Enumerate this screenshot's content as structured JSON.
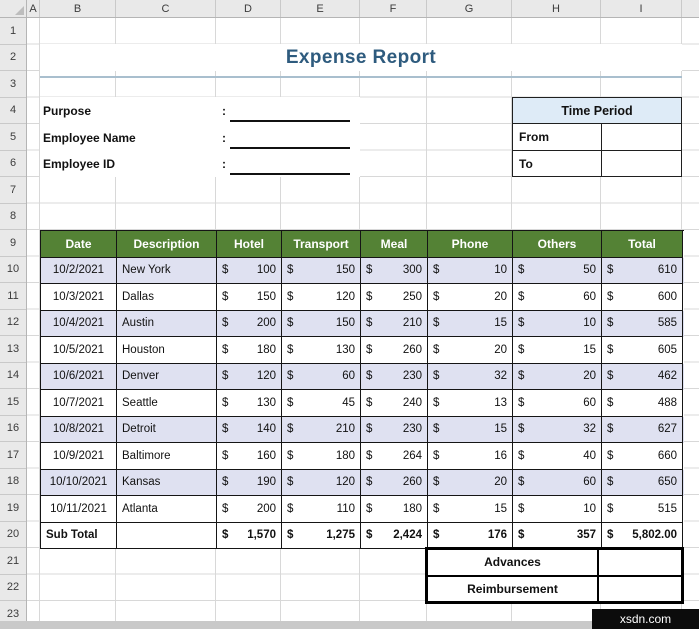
{
  "grid": {
    "columns": [
      "A",
      "B",
      "C",
      "D",
      "E",
      "F",
      "G",
      "H",
      "I"
    ],
    "rows": [
      "1",
      "2",
      "3",
      "4",
      "5",
      "6",
      "7",
      "8",
      "9",
      "10",
      "11",
      "12",
      "13",
      "14",
      "15",
      "16",
      "17",
      "18",
      "19",
      "20",
      "21",
      "22",
      "23"
    ]
  },
  "report": {
    "title": "Expense Report",
    "fields": {
      "purpose": {
        "label": "Purpose",
        "separator": ":",
        "value": ""
      },
      "employee_name": {
        "label": "Employee Name",
        "separator": ":",
        "value": ""
      },
      "employee_id": {
        "label": "Employee ID",
        "separator": ":",
        "value": ""
      }
    },
    "time_period": {
      "header": "Time Period",
      "from_label": "From",
      "from_value": "",
      "to_label": "To",
      "to_value": ""
    }
  },
  "expense_table": {
    "currency": "$",
    "headers": [
      "Date",
      "Description",
      "Hotel",
      "Transport",
      "Meal",
      "Phone",
      "Others",
      "Total"
    ],
    "rows": [
      {
        "date": "10/2/2021",
        "description": "New York",
        "hotel": "100",
        "transport": "150",
        "meal": "300",
        "phone": "10",
        "others": "50",
        "total": "610"
      },
      {
        "date": "10/3/2021",
        "description": "Dallas",
        "hotel": "150",
        "transport": "120",
        "meal": "250",
        "phone": "20",
        "others": "60",
        "total": "600"
      },
      {
        "date": "10/4/2021",
        "description": "Austin",
        "hotel": "200",
        "transport": "150",
        "meal": "210",
        "phone": "15",
        "others": "10",
        "total": "585"
      },
      {
        "date": "10/5/2021",
        "description": "Houston",
        "hotel": "180",
        "transport": "130",
        "meal": "260",
        "phone": "20",
        "others": "15",
        "total": "605"
      },
      {
        "date": "10/6/2021",
        "description": "Denver",
        "hotel": "120",
        "transport": "60",
        "meal": "230",
        "phone": "32",
        "others": "20",
        "total": "462"
      },
      {
        "date": "10/7/2021",
        "description": "Seattle",
        "hotel": "130",
        "transport": "45",
        "meal": "240",
        "phone": "13",
        "others": "60",
        "total": "488"
      },
      {
        "date": "10/8/2021",
        "description": "Detroit",
        "hotel": "140",
        "transport": "210",
        "meal": "230",
        "phone": "15",
        "others": "32",
        "total": "627"
      },
      {
        "date": "10/9/2021",
        "description": "Baltimore",
        "hotel": "160",
        "transport": "180",
        "meal": "264",
        "phone": "16",
        "others": "40",
        "total": "660"
      },
      {
        "date": "10/10/2021",
        "description": "Kansas",
        "hotel": "190",
        "transport": "120",
        "meal": "260",
        "phone": "20",
        "others": "60",
        "total": "650"
      },
      {
        "date": "10/11/2021",
        "description": "Atlanta",
        "hotel": "200",
        "transport": "110",
        "meal": "180",
        "phone": "15",
        "others": "10",
        "total": "515"
      }
    ],
    "subtotal": {
      "label": "Sub Total",
      "hotel": "1,570",
      "transport": "1,275",
      "meal": "2,424",
      "phone": "176",
      "others": "357",
      "total": "5,802.00"
    }
  },
  "settlement": {
    "advances_label": "Advances",
    "advances_value": "",
    "reimbursement_label": "Reimbursement",
    "reimbursement_value": ""
  },
  "watermark": {
    "text": "xsdn.com"
  },
  "colors": {
    "table_header_green": "#548235",
    "row_alt_lavender": "#dfe1f1",
    "time_period_blue": "#deebf7",
    "title_blue": "#2e5b7e"
  }
}
